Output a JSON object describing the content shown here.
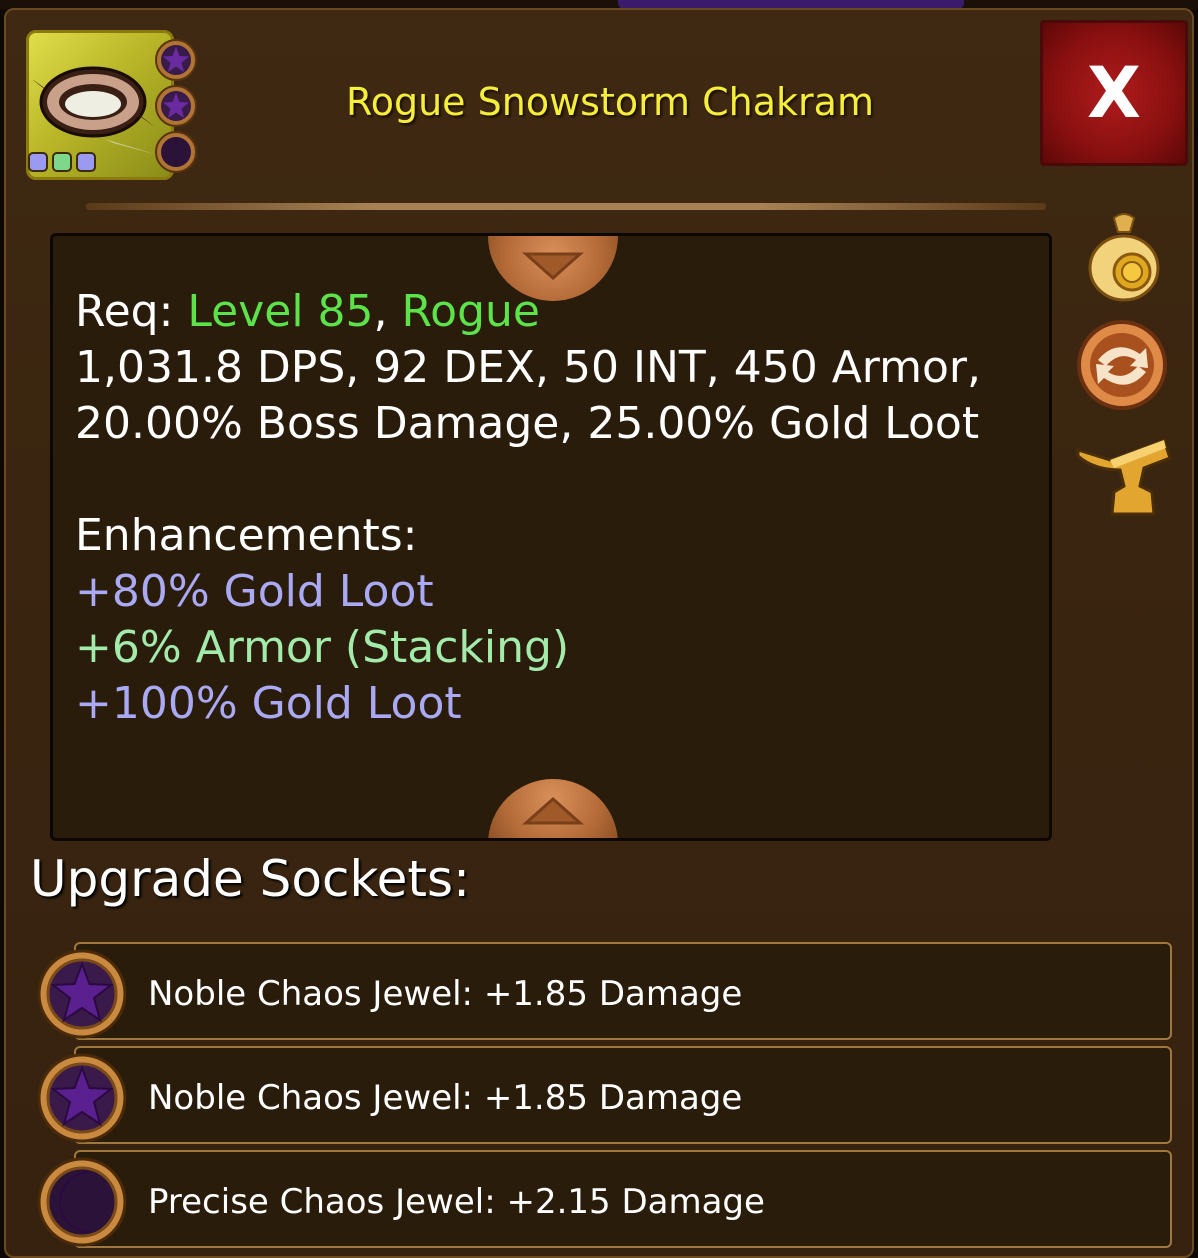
{
  "item": {
    "name": "Rogue Snowstorm Chakram",
    "icon": "chakram-icon",
    "rarity_dots": [
      "#9a9af0",
      "#7fd88a",
      "#9a9af0"
    ],
    "socket_icons": [
      "star-jewel-icon",
      "star-jewel-icon",
      "moon-jewel-icon"
    ]
  },
  "close_label": "X",
  "description": {
    "req_label": "Req:",
    "req_level": "Level 85",
    "req_sep": ",",
    "req_class": "Rogue",
    "stats_line1": "1,031.8 DPS, 92 DEX, 50 INT, 450 Armor,",
    "stats_line2": "20.00% Boss Damage, 25.00% Gold Loot",
    "enhancements_label": "Enhancements:",
    "enhancements": [
      "+80% Gold Loot",
      "+6% Armor (Stacking)",
      "+100% Gold Loot"
    ]
  },
  "side_actions": [
    "sell-gold-bag-icon",
    "swap-icon",
    "anvil-icon"
  ],
  "sockets": {
    "heading": "Upgrade Sockets:",
    "items": [
      {
        "label": "Noble Chaos Jewel: +1.85 Damage",
        "icon": "star-jewel-icon"
      },
      {
        "label": "Noble Chaos Jewel: +1.85 Damage",
        "icon": "star-jewel-icon"
      },
      {
        "label": "Precise Chaos Jewel: +2.15 Damage",
        "icon": "moon-jewel-icon"
      }
    ]
  },
  "colors": {
    "title": "#f5ee3a",
    "requirement": "#5de34a",
    "enhancement_blue": "#aaa9f3",
    "enhancement_green": "#a2ebaa",
    "close_button": "#a01818"
  }
}
